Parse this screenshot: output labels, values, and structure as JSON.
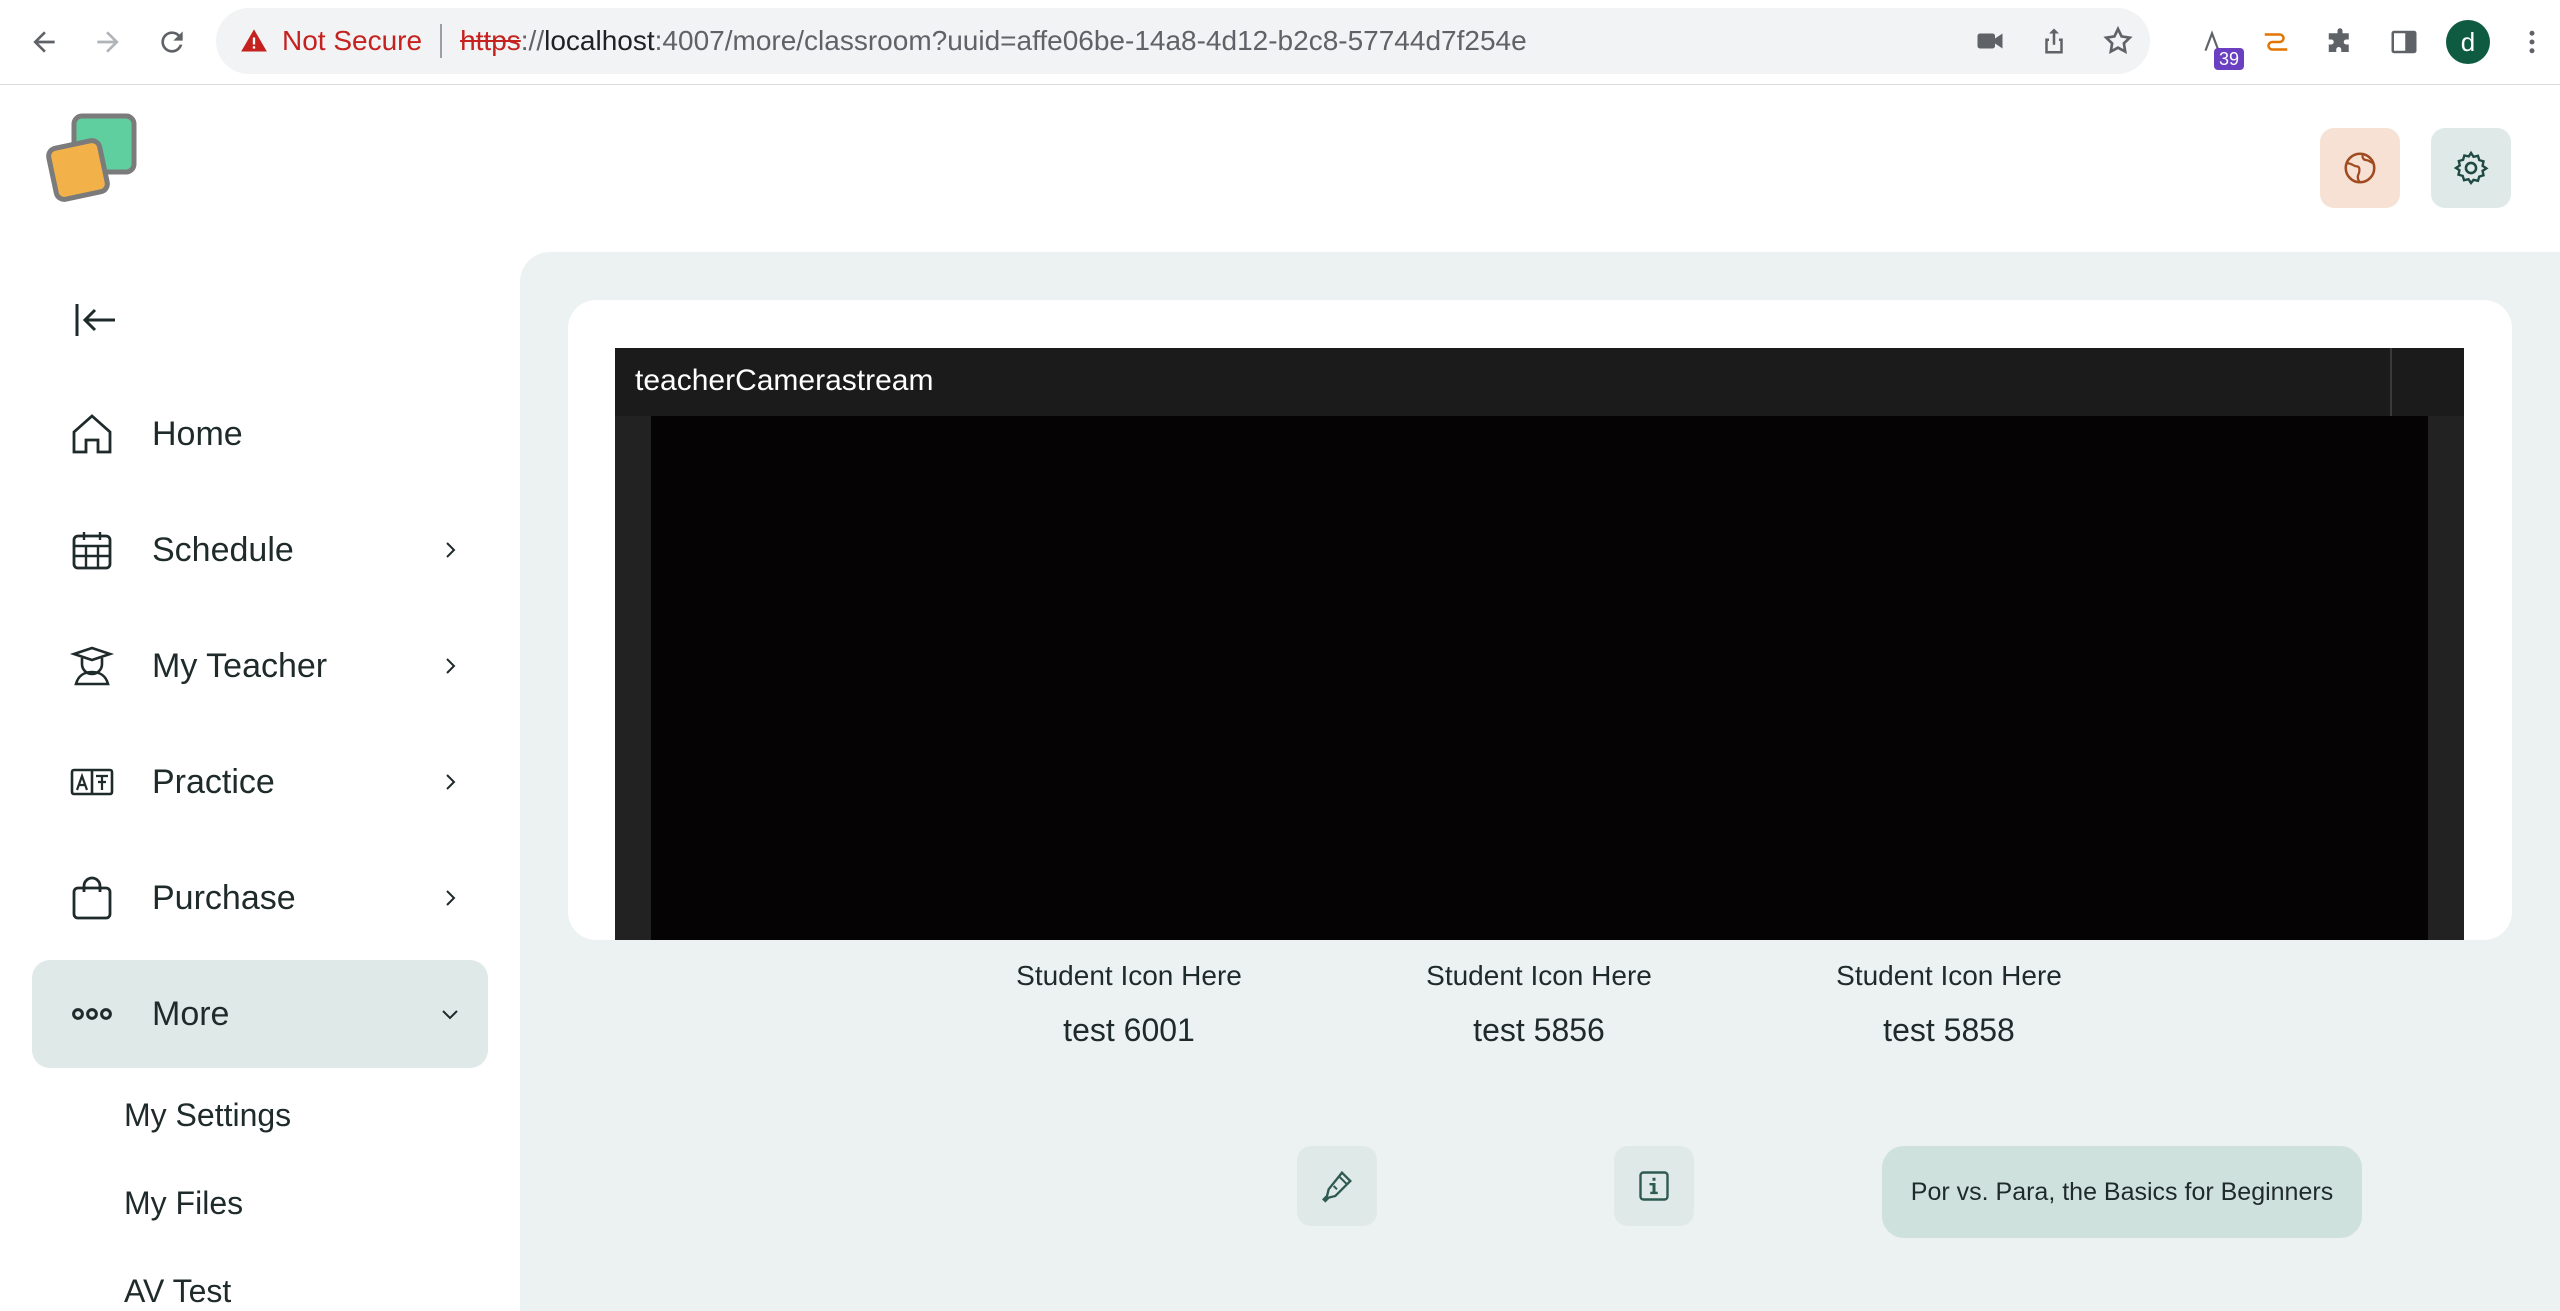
{
  "browser": {
    "security_label": "Not Secure",
    "url_scheme": "https",
    "url_sep": "://",
    "url_host": "localhost",
    "url_rest": ":4007/more/classroom?uuid=affe06be-14a8-4d12-b2c8-57744d7f254e",
    "extension_badge": "39",
    "profile_initial": "d"
  },
  "sidebar": {
    "items": [
      {
        "label": "Home",
        "icon": "home-icon"
      },
      {
        "label": "Schedule",
        "icon": "calendar-icon"
      },
      {
        "label": "My Teacher",
        "icon": "teacher-icon"
      },
      {
        "label": "Practice",
        "icon": "translate-icon"
      },
      {
        "label": "Purchase",
        "icon": "shopping-bag-icon"
      },
      {
        "label": "More",
        "icon": "more-dots-icon"
      }
    ],
    "more_sub": [
      "My Settings",
      "My Files",
      "AV Test"
    ]
  },
  "classroom": {
    "camera_label": "teacherCamerastream",
    "students": [
      {
        "icon_text": "Student Icon Here",
        "name": "test 6001"
      },
      {
        "icon_text": "Student Icon Here",
        "name": "test 5856"
      },
      {
        "icon_text": "Student Icon Here",
        "name": "test 5858"
      }
    ],
    "lesson_title": "Por vs. Para, the Basics for Beginners"
  },
  "colors": {
    "accent": "#1f2a2a",
    "active_bg": "#dfe9e7",
    "lang_bg": "#f7e1d4",
    "lesson_bg": "#cfe1dd",
    "main_bg": "#ecf1f2"
  }
}
